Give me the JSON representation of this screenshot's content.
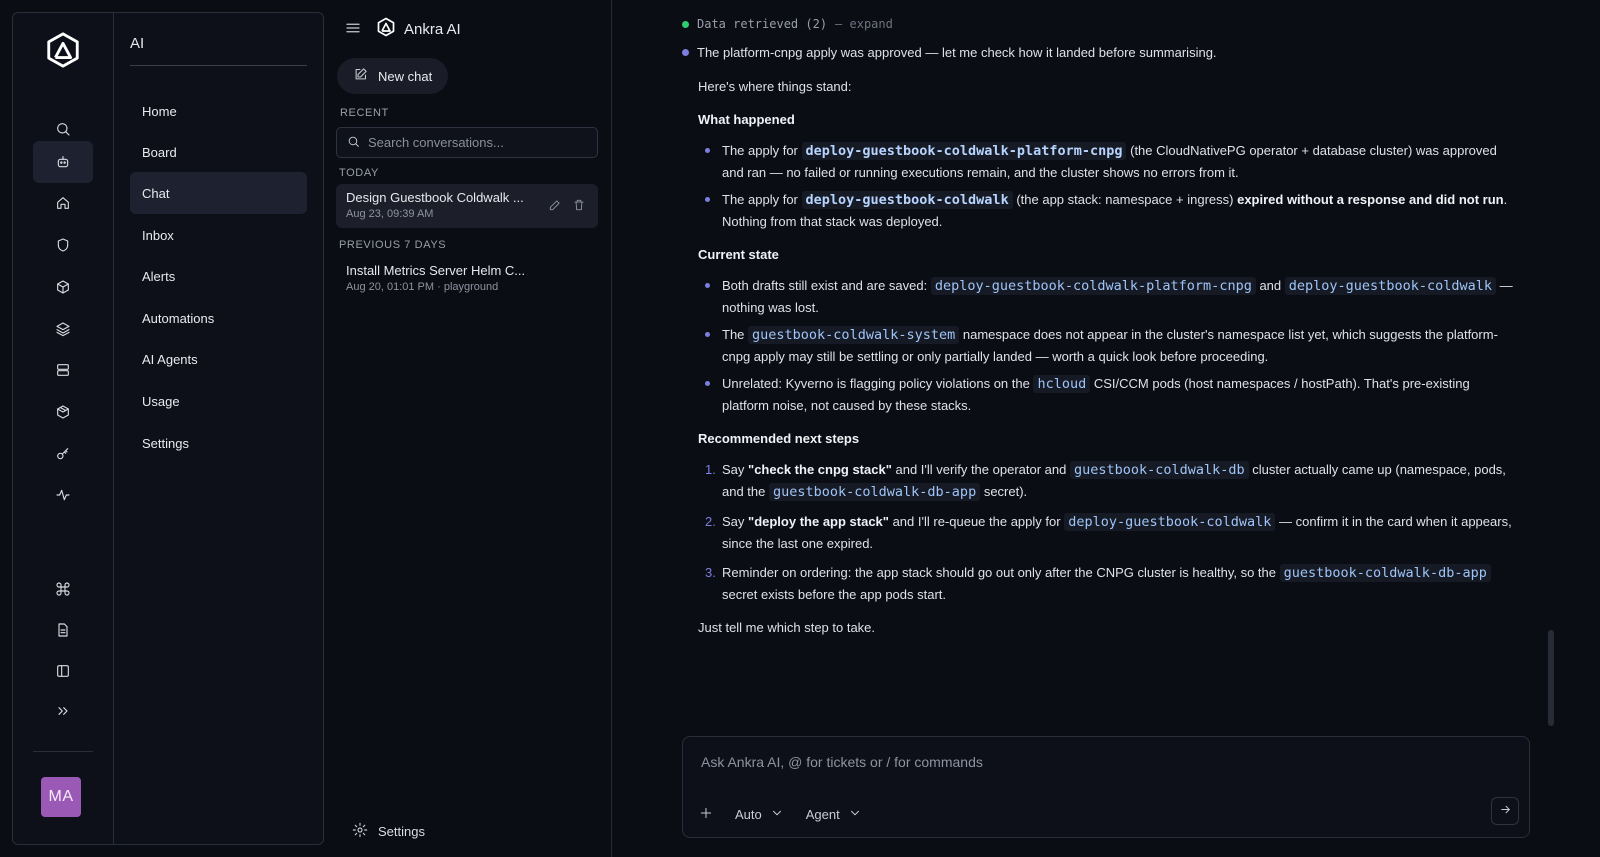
{
  "rail": {
    "user_initials": "MA",
    "avatar_color": "#9b59b6"
  },
  "section": {
    "title": "AI",
    "items": [
      {
        "label": "Home"
      },
      {
        "label": "Board"
      },
      {
        "label": "Chat",
        "active": true
      },
      {
        "label": "Inbox"
      },
      {
        "label": "Alerts"
      },
      {
        "label": "Automations"
      },
      {
        "label": "AI Agents"
      },
      {
        "label": "Usage"
      },
      {
        "label": "Settings"
      }
    ]
  },
  "chatlist": {
    "brand": "Ankra AI",
    "new_chat": "New chat",
    "recent_label": "RECENT",
    "search_placeholder": "Search conversations...",
    "today_label": "TODAY",
    "prev_label": "PREVIOUS 7 DAYS",
    "today": [
      {
        "title": "Design Guestbook Coldwalk ...",
        "meta": "Aug 23, 09:39 AM"
      }
    ],
    "previous": [
      {
        "title": "Install Metrics Server Helm C...",
        "meta": "Aug 20, 01:01 PM · playground"
      }
    ],
    "settings": "Settings"
  },
  "message": {
    "data_retrieved": "Data retrieved (2)",
    "expand": "— expand",
    "intro": "The platform-cnpg apply was approved — let me check how it landed before summarising.",
    "lead": "Here's where things stand:",
    "h_happened": "What happened",
    "happened": [
      {
        "pre": "The apply for",
        "code": "deploy-guestbook-coldwalk-platform-cnpg",
        "post": "(the CloudNativePG operator + database cluster) was approved and ran — no failed or running executions remain, and the cluster shows no errors from it."
      },
      {
        "pre": "The apply for",
        "code": "deploy-guestbook-coldwalk",
        "post": "(the app stack: namespace + ingress)",
        "bold": "expired without a response and did not run",
        "tail": ". Nothing from that stack was deployed."
      }
    ],
    "h_state": "Current state",
    "state": [
      {
        "pre": "Both drafts still exist and are saved:",
        "code1": "deploy-guestbook-coldwalk-platform-cnpg",
        "mid": "and",
        "code2": "deploy-guestbook-coldwalk",
        "post": "— nothing was lost."
      },
      {
        "pre": "The",
        "code": "guestbook-coldwalk-system",
        "post": "namespace does not appear in the cluster's namespace list yet, which suggests the platform-cnpg apply may still be settling or only partially landed — worth a quick look before proceeding."
      },
      {
        "pre": "Unrelated: Kyverno is flagging policy violations on the",
        "code": "hcloud",
        "post": "CSI/CCM pods (host namespaces / hostPath). That's pre-existing platform noise, not caused by these stacks."
      }
    ],
    "h_next": "Recommended next steps",
    "steps": [
      {
        "n": "1.",
        "pre": "Say",
        "bold": "\"check the cnpg stack\"",
        "mid": "and I'll verify the operator and",
        "code1": "guestbook-coldwalk-db",
        "mid2": "cluster actually came up (namespace, pods, and the",
        "code2": "guestbook-coldwalk-db-app",
        "post": "secret)."
      },
      {
        "n": "2.",
        "pre": "Say",
        "bold": "\"deploy the app stack\"",
        "mid": "and I'll re-queue the apply for",
        "code": "deploy-guestbook-coldwalk",
        "post": "— confirm it in the card when it appears, since the last one expired."
      },
      {
        "n": "3.",
        "pre": "Reminder on ordering: the app stack should go out only after the CNPG cluster is healthy, so the",
        "code": "guestbook-coldwalk-db-app",
        "post": "secret exists before the app pods start."
      }
    ],
    "closing": "Just tell me which step to take."
  },
  "composer": {
    "placeholder": "Ask Ankra AI, @ for tickets or / for commands",
    "mode": "Auto",
    "agent": "Agent"
  },
  "colors": {
    "accent": "#7c7fe0",
    "status_green": "#2ecc71",
    "code_text": "#9fc4f7"
  }
}
